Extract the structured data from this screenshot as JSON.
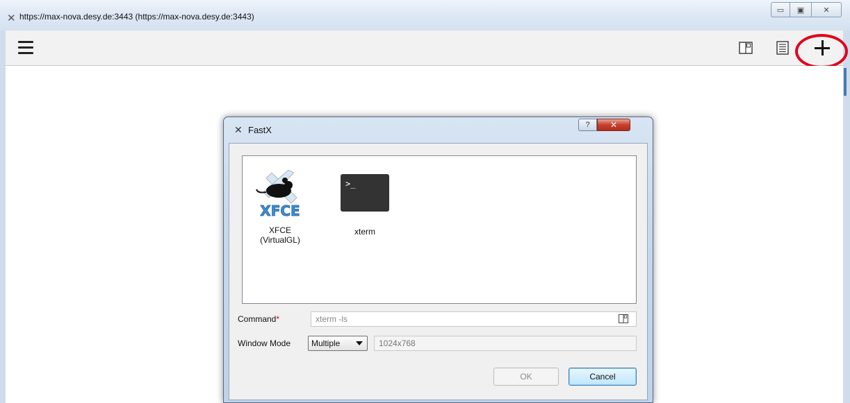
{
  "window": {
    "title": "https://max-nova.desy.de:3443 (https://max-nova.desy.de:3443)",
    "icon": "x-logo-icon",
    "controls": {
      "minimize": "▭",
      "maximize": "▣",
      "close": "✕"
    }
  },
  "toolbar": {
    "menu_icon": "hamburger-menu-icon",
    "icons": [
      "window-mode-icon",
      "session-list-icon",
      "plus-icon"
    ],
    "highlight_color": "#e0001b"
  },
  "dialog": {
    "title": "FastX",
    "icon": "x-logo-icon",
    "help_label": "?",
    "close_label": "✕",
    "sessions": [
      {
        "label": "XFCE (VirtualGL)",
        "icon": "xfce-mouse-icon"
      },
      {
        "label": "xterm",
        "icon": "terminal-icon",
        "prompt": ">_"
      }
    ],
    "command": {
      "label": "Command",
      "required_mark": "*",
      "value": "xterm -ls"
    },
    "window_mode": {
      "label": "Window Mode",
      "selected": "Multiple",
      "geometry_placeholder": "1024x768"
    },
    "ok_label": "OK",
    "cancel_label": "Cancel"
  }
}
